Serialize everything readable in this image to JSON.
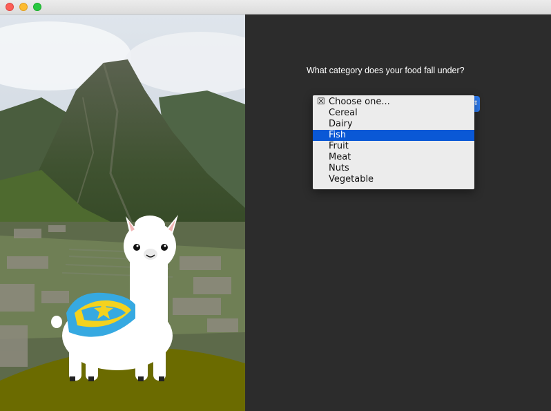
{
  "window": {
    "controls": [
      "close",
      "minimize",
      "maximize"
    ]
  },
  "question": "What category does your food fall under?",
  "dropdown": {
    "checked_icon": "ballot-x-icon",
    "options": [
      "Choose one...",
      "Cereal",
      "Dairy",
      "Fish",
      "Fruit",
      "Meat",
      "Nuts",
      "Vegetable"
    ],
    "checked_option": "Choose one...",
    "highlighted_option": "Fish"
  },
  "colors": {
    "background": "#2c2c2c",
    "highlight": "#0a58d6",
    "popup_button": "#2d7bf0",
    "menu_bg": "#ececec",
    "grass_hill": "#6b6b00"
  },
  "scene": {
    "description_icons": [
      "mountain-photo",
      "llama-illustration"
    ]
  }
}
